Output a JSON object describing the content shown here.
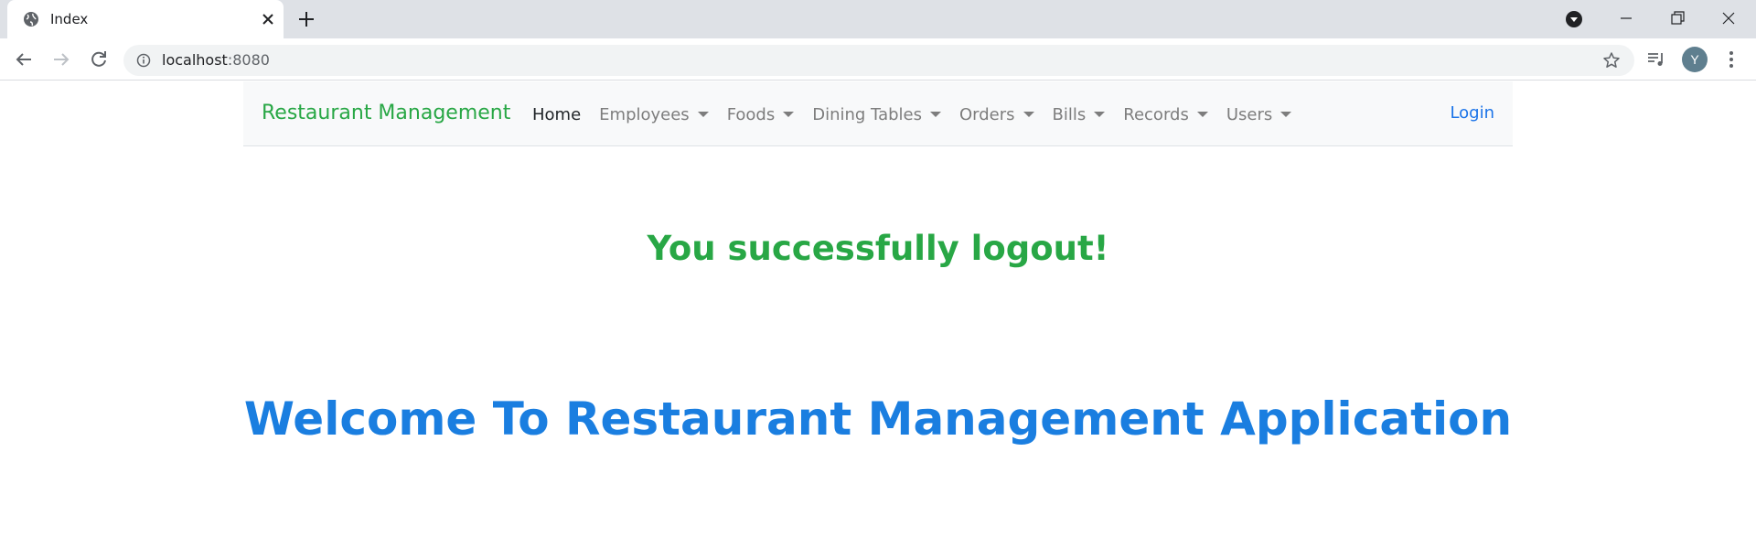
{
  "browser": {
    "tab_title": "Index",
    "url_host": "localhost",
    "url_port": ":8080",
    "profile_initial": "Y"
  },
  "navbar": {
    "brand": "Restaurant Management",
    "items": [
      {
        "label": "Home",
        "dropdown": false,
        "active": true
      },
      {
        "label": "Employees",
        "dropdown": true
      },
      {
        "label": "Foods",
        "dropdown": true
      },
      {
        "label": "Dining Tables",
        "dropdown": true
      },
      {
        "label": "Orders",
        "dropdown": true
      },
      {
        "label": "Bills",
        "dropdown": true
      },
      {
        "label": "Records",
        "dropdown": true
      },
      {
        "label": "Users",
        "dropdown": true
      }
    ],
    "login": "Login"
  },
  "main": {
    "message": "You successfully logout!",
    "welcome": "Welcome To Restaurant Management Application"
  },
  "colors": {
    "brand_green": "#28a745",
    "link_blue": "#1a73e8",
    "heading_blue": "#1a7ee0",
    "navbar_bg": "#f8f9fa"
  }
}
